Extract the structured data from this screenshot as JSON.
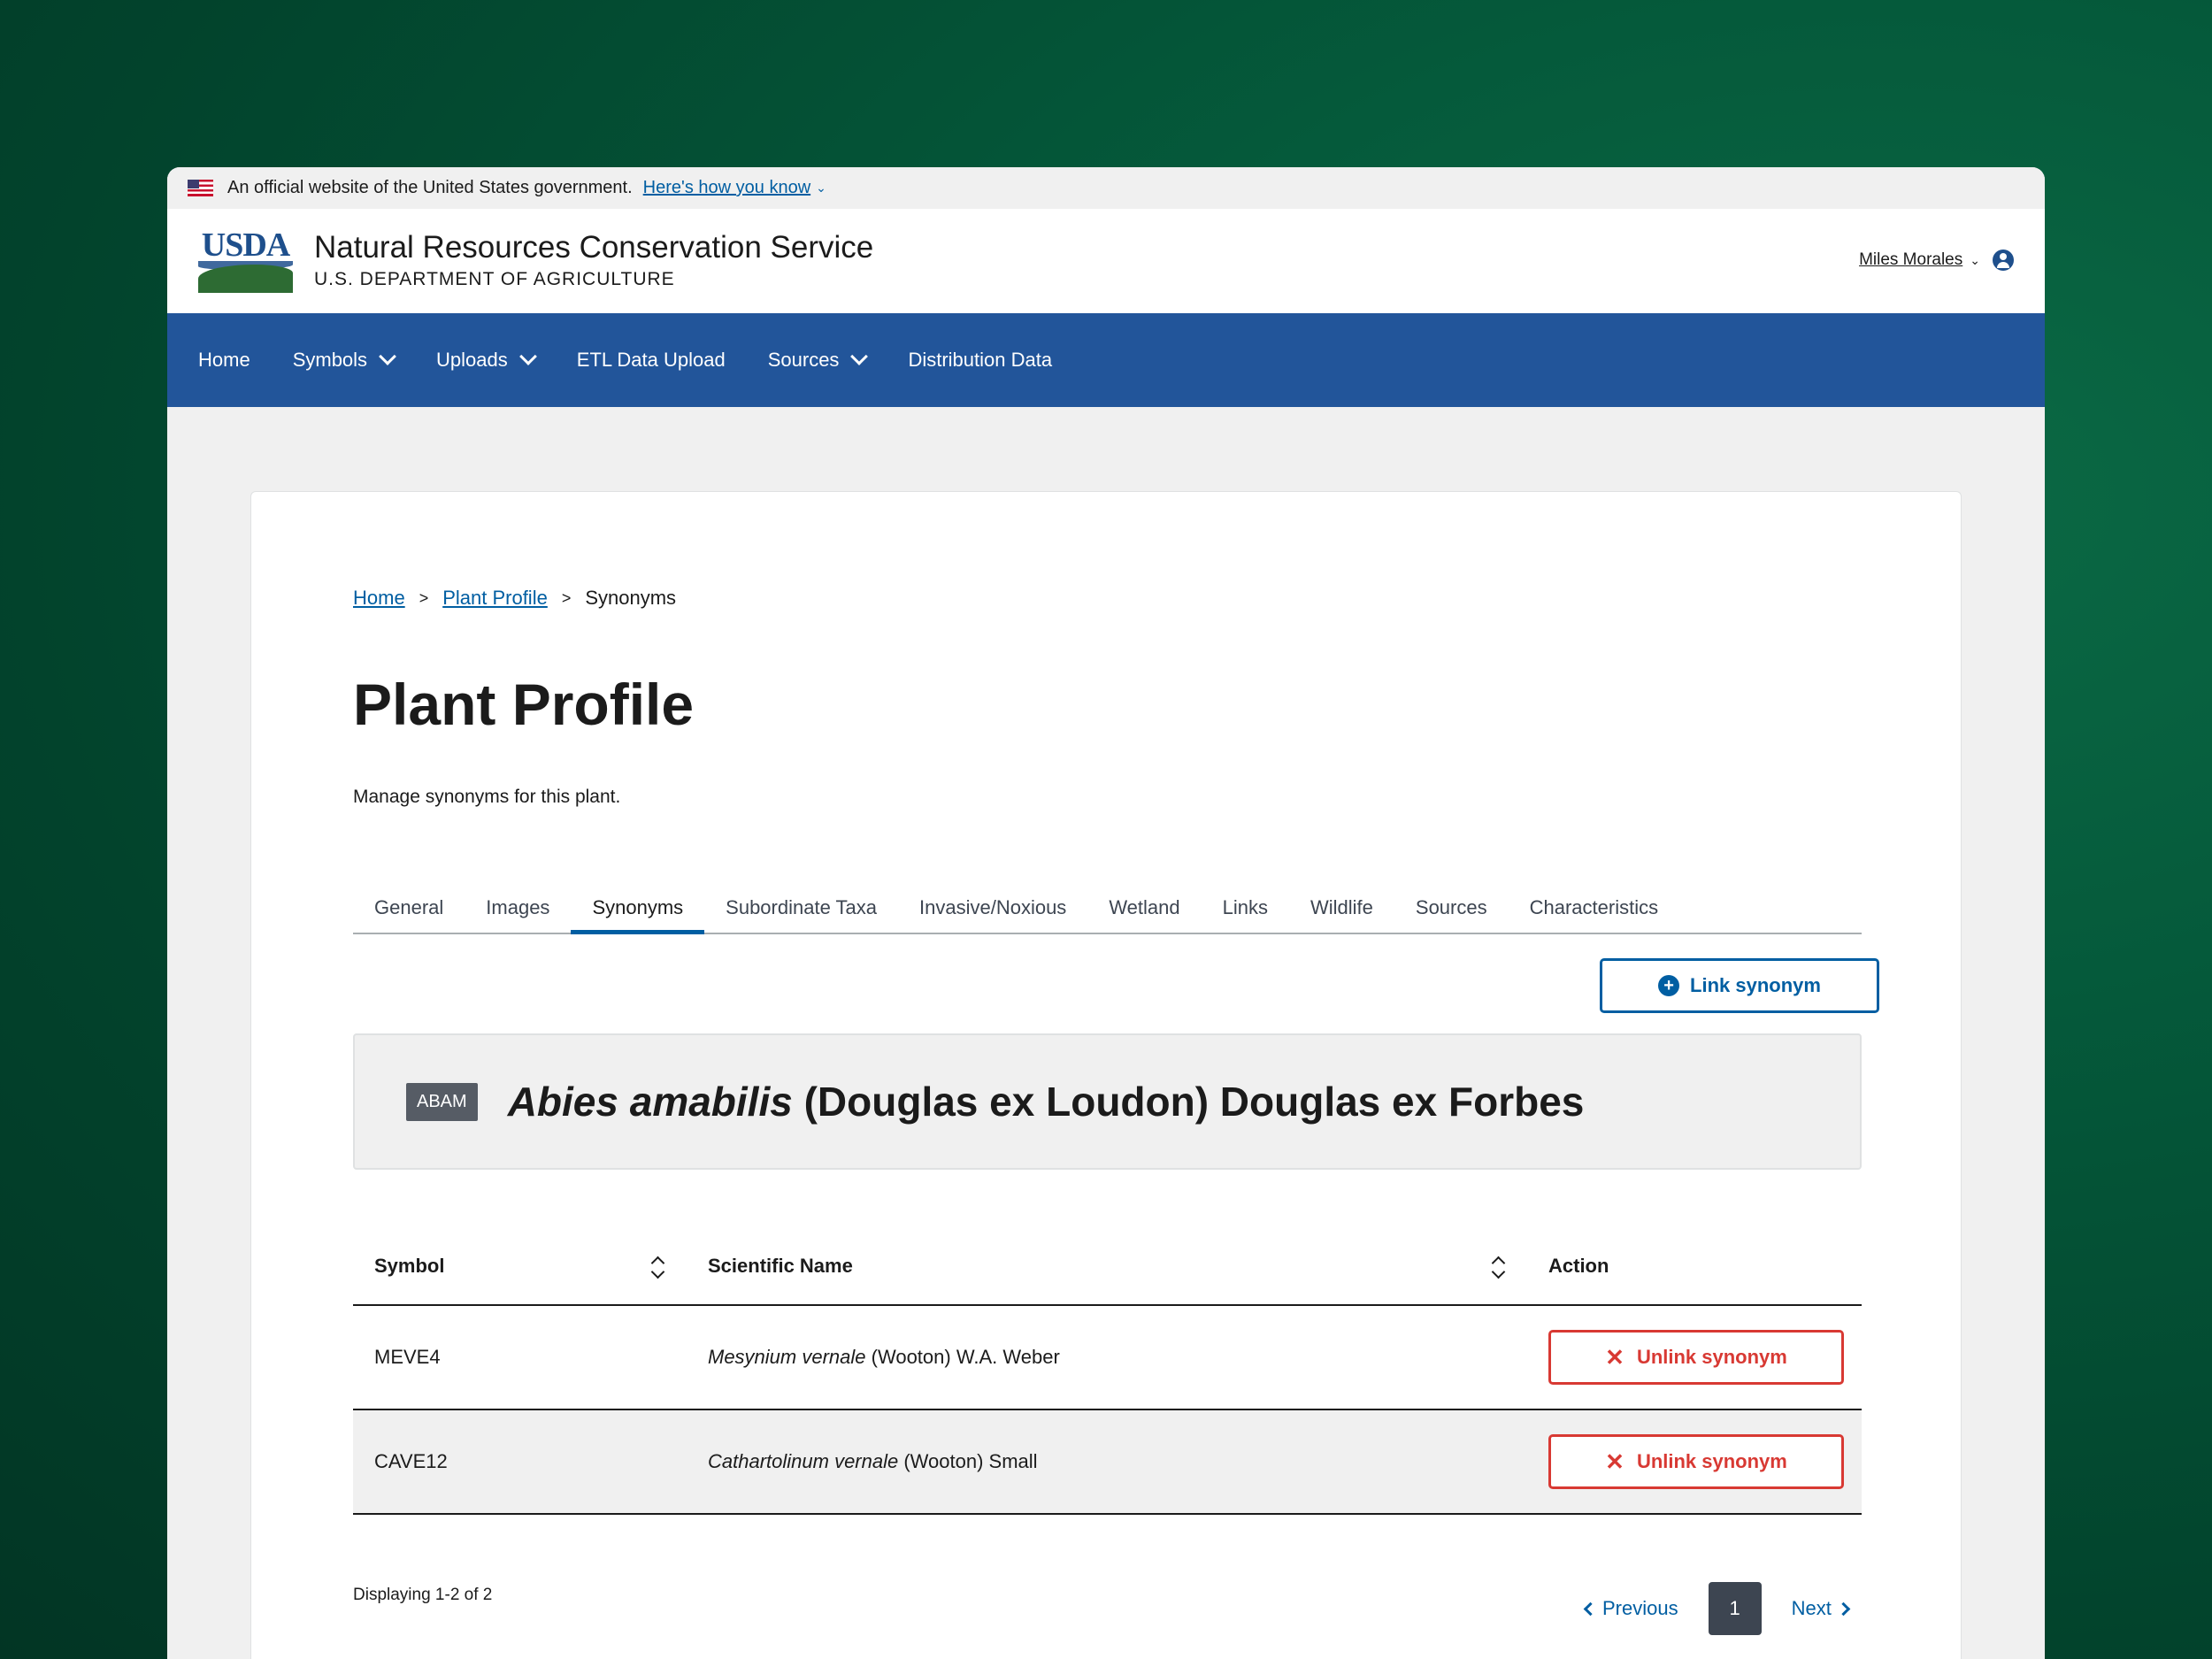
{
  "gov_banner": {
    "text": "An official website of the United States government.",
    "link": "Here's how you know"
  },
  "header": {
    "logo_text": "USDA",
    "agency": "Natural Resources Conservation Service",
    "department": "U.S. DEPARTMENT OF AGRICULTURE",
    "user": "Miles Morales"
  },
  "nav": {
    "home": "Home",
    "symbols": "Symbols",
    "uploads": "Uploads",
    "etl": "ETL Data Upload",
    "sources": "Sources",
    "distribution": "Distribution Data"
  },
  "breadcrumb": {
    "home": "Home",
    "plant_profile": "Plant Profile",
    "current": "Synonyms"
  },
  "page": {
    "title": "Plant Profile",
    "description": "Manage synonyms for this plant."
  },
  "tabs": [
    "General",
    "Images",
    "Synonyms",
    "Subordinate Taxa",
    "Invasive/Noxious",
    "Wetland",
    "Links",
    "Wildlife",
    "Sources",
    "Characteristics"
  ],
  "active_tab": "Synonyms",
  "link_button": "Link synonym",
  "plant": {
    "symbol": "ABAM",
    "genus_species": "Abies amabilis",
    "authority": "(Douglas ex Loudon) Douglas ex Forbes"
  },
  "table": {
    "headers": {
      "symbol": "Symbol",
      "name": "Scientific Name",
      "action": "Action"
    },
    "rows": [
      {
        "symbol": "MEVE4",
        "species": "Mesynium vernale",
        "authority": "(Wooton) W.A. Weber",
        "action": "Unlink synonym"
      },
      {
        "symbol": "CAVE12",
        "species": "Cathartolinum vernale",
        "authority": "(Wooton) Small",
        "action": "Unlink synonym"
      }
    ]
  },
  "pagination": {
    "displaying": "Displaying 1-2 of 2",
    "previous": "Previous",
    "current_page": "1",
    "next": "Next"
  },
  "colors": {
    "nav_bg": "#22559a",
    "link": "#005ea2",
    "danger": "#d83933"
  }
}
